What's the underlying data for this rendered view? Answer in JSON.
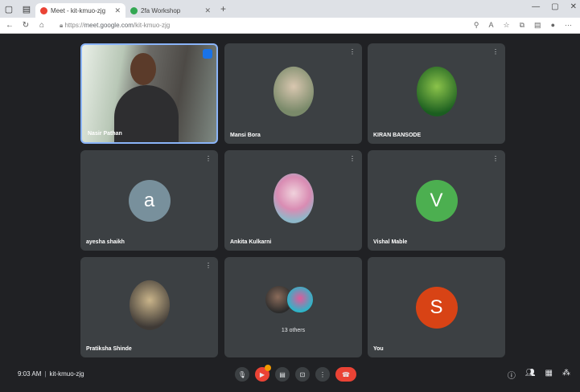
{
  "browser": {
    "tabs": [
      {
        "label": "Meet - kit-kmuo-zjg",
        "active": true,
        "favicon_color": "#ea4335"
      },
      {
        "label": "2fa Workshop",
        "active": false,
        "favicon_color": "#34a853"
      }
    ],
    "url_prefix": "https://",
    "url_host": "meet.google.com",
    "url_path": "/kit-kmuo-zjg"
  },
  "tiles": [
    {
      "name": "Nasir Pathan",
      "kind": "video"
    },
    {
      "name": "Mansi Bora",
      "kind": "photo",
      "photo_colors": [
        "#7a8a6a",
        "#d9c7b0"
      ]
    },
    {
      "name": "KIRAN BANSODE",
      "kind": "photo",
      "photo_colors": [
        "#4caf50",
        "#1b5e20"
      ]
    },
    {
      "name": "ayesha shaikh",
      "kind": "letter",
      "letter": "a",
      "color": "#78909c"
    },
    {
      "name": "Ankita Kulkarni",
      "kind": "photo",
      "photo_colors": [
        "#d98cb3",
        "#8fb7c9"
      ]
    },
    {
      "name": "Vishal Mable",
      "kind": "letter",
      "letter": "V",
      "color": "#4caf50"
    },
    {
      "name": "Pratiksha Shinde",
      "kind": "photo",
      "photo_colors": [
        "#c9b48a",
        "#3f3a36"
      ]
    },
    {
      "name": "",
      "kind": "others",
      "others_label": "13 others"
    },
    {
      "name": "You",
      "kind": "letter",
      "letter": "S",
      "color": "#d84315"
    }
  ],
  "bottom": {
    "time": "9:03 AM",
    "meeting_code": "kit-kmuo-zjg",
    "controls": [
      "mic-icon",
      "camera-icon",
      "captions-icon",
      "present-icon",
      "more-options-icon",
      "hangup-icon"
    ],
    "right_controls": [
      "info-icon",
      "people-icon",
      "chat-icon",
      "activities-icon"
    ]
  }
}
